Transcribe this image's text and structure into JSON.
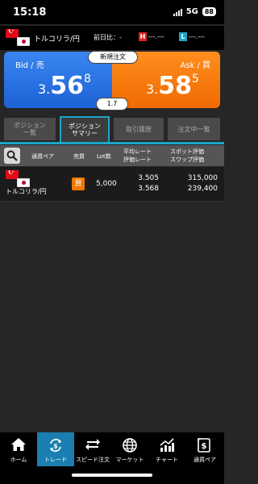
{
  "status_bar": {
    "time": "15:18",
    "network": "5G",
    "battery": "88"
  },
  "header": {
    "pair_name": "トルコリラ/円",
    "prev_diff": "前日比：-",
    "high_badge": "H",
    "high_value": "---.---",
    "low_badge": "L",
    "low_value": "---.---"
  },
  "quote": {
    "new_order_label": "新規注文",
    "bid_label": "Bid / 売",
    "bid_lead": "3.",
    "bid_main": "56",
    "bid_sup": "8",
    "ask_label": "Ask / 買",
    "ask_lead": "3.",
    "ask_main": "58",
    "ask_sup": "5",
    "spread": "1.7"
  },
  "tabs": {
    "position_list_line1": "ポジション",
    "position_list_line2": "一覧",
    "position_summary_line1": "ポジション",
    "position_summary_line2": "サマリー",
    "trade_history": "取引履歴",
    "open_orders": "注文中一覧"
  },
  "table": {
    "headers": {
      "pair": "通貨ペア",
      "side": "売買",
      "lot": "Lot数",
      "avg_rate": "平均レート",
      "eval_rate": "評価レート",
      "spot_eval": "スポット評価",
      "swap_eval": "スワップ評価"
    },
    "rows": [
      {
        "pair": "トルコリラ/円",
        "side": "買",
        "lot": "5,000",
        "avg_rate": "3.505",
        "eval_rate": "3.568",
        "spot_eval": "315,000",
        "swap_eval": "239,400"
      }
    ]
  },
  "nav": {
    "home": "ホーム",
    "trade": "トレード",
    "speed_order": "スピード注文",
    "market": "マーケット",
    "chart": "チャート",
    "pairs": "通貨ペア"
  },
  "colors": {
    "bid": "#2a74e6",
    "ask": "#f57a0a",
    "accent": "#1aa6c9",
    "high": "#e02020",
    "buy_badge": "#f07800"
  }
}
